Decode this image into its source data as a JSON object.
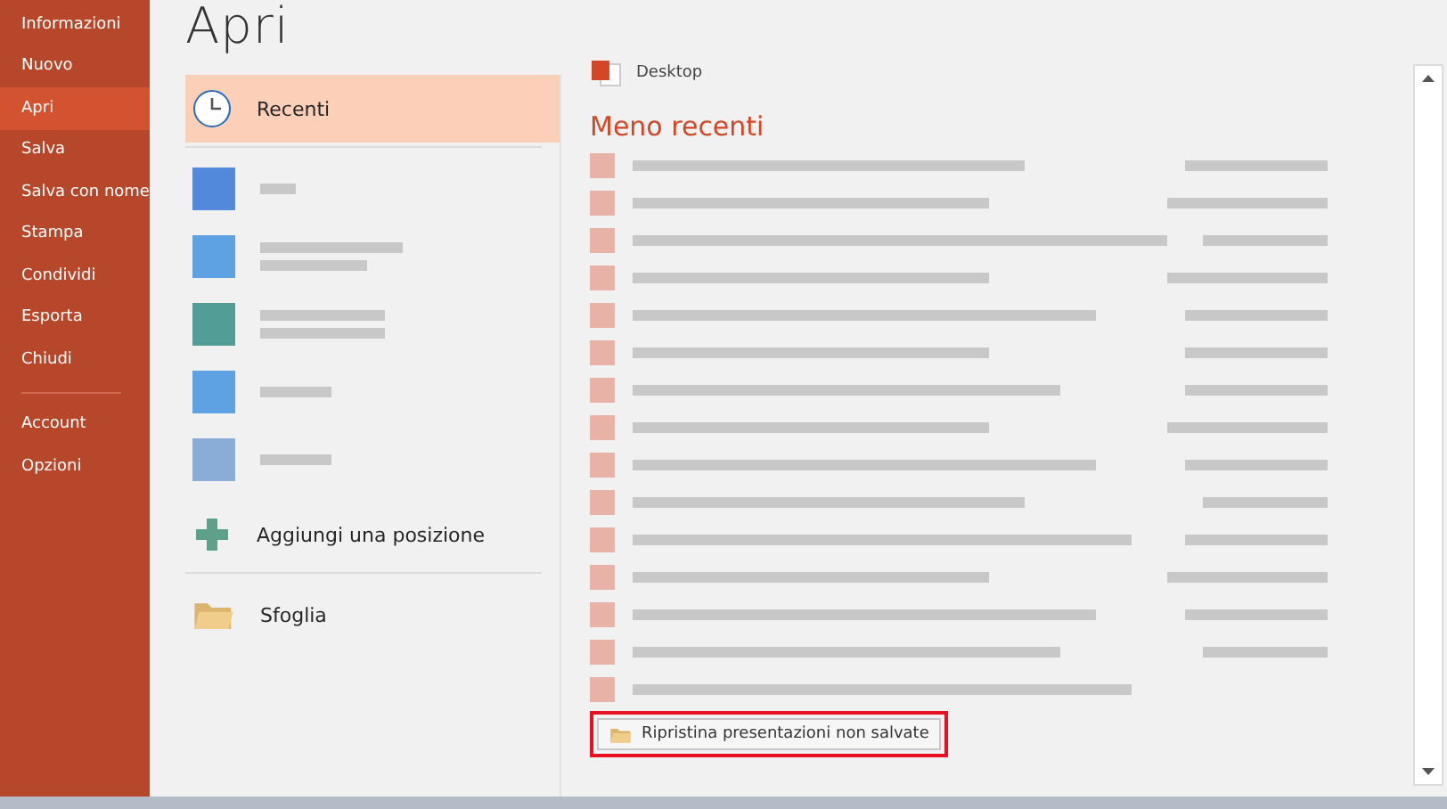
{
  "sidebar": {
    "items": [
      {
        "label": "Informazioni",
        "selected": false
      },
      {
        "label": "Nuovo",
        "selected": false
      },
      {
        "label": "Apri",
        "selected": true
      },
      {
        "label": "Salva",
        "selected": false
      },
      {
        "label": "Salva con nome",
        "selected": false
      },
      {
        "label": "Stampa",
        "selected": false
      },
      {
        "label": "Condividi",
        "selected": false
      },
      {
        "label": "Esporta",
        "selected": false
      },
      {
        "label": "Chiudi",
        "selected": false
      }
    ],
    "footer_items": [
      {
        "label": "Account",
        "selected": false
      },
      {
        "label": "Opzioni",
        "selected": false
      }
    ]
  },
  "page_title": "Apri",
  "places": {
    "recent": {
      "label": "Recenti",
      "selected": true
    },
    "add_place": "Aggiungi una posizione",
    "browse": "Sfoglia"
  },
  "files": {
    "top_row_location": "Desktop",
    "older_heading": "Meno recenti"
  },
  "recover_button": {
    "label": "Ripristina presentazioni non salvate",
    "highlighted": true
  }
}
